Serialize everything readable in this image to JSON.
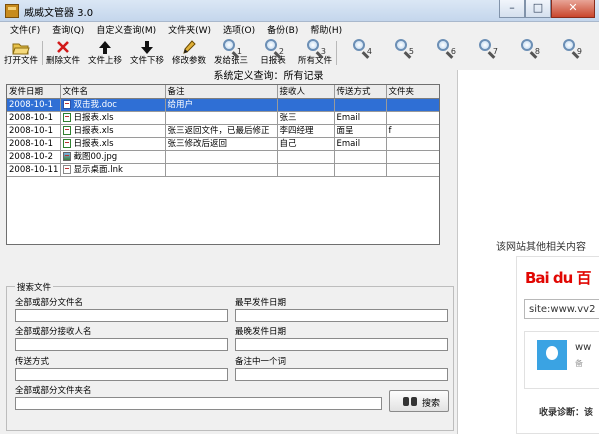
{
  "window": {
    "title": "威威文管器 3.0"
  },
  "menu": [
    "文件(F)",
    "查询(Q)",
    "自定义查询(M)",
    "文件夹(W)",
    "选项(O)",
    "备份(B)",
    "帮助(H)"
  ],
  "toolbar": [
    {
      "label": "打开文件",
      "icon": "open-folder-icon"
    },
    {
      "label": "删除文件",
      "icon": "delete-x-icon"
    },
    {
      "label": "文件上移",
      "icon": "arrow-up-icon"
    },
    {
      "label": "文件下移",
      "icon": "arrow-down-icon"
    },
    {
      "label": "修改参数",
      "icon": "pencil-icon"
    },
    {
      "label": "发给张三",
      "icon": "magnifier-icon",
      "num": "1"
    },
    {
      "label": "日报表",
      "icon": "magnifier-icon",
      "num": "2"
    },
    {
      "label": "所有文件",
      "icon": "magnifier-icon",
      "num": "3"
    },
    {
      "label": "",
      "icon": "magnifier-icon",
      "num": "4"
    },
    {
      "label": "",
      "icon": "magnifier-icon",
      "num": "5"
    },
    {
      "label": "",
      "icon": "magnifier-icon",
      "num": "6"
    },
    {
      "label": "",
      "icon": "magnifier-icon",
      "num": "7"
    },
    {
      "label": "",
      "icon": "magnifier-icon",
      "num": "8"
    },
    {
      "label": "",
      "icon": "magnifier-icon",
      "num": "9"
    }
  ],
  "query_title": "系统定义查询：所有记录",
  "table": {
    "headers": [
      "发件日期",
      "文件名",
      "备注",
      "接收人",
      "传送方式",
      "文件夹"
    ],
    "rows": [
      {
        "date": "2008-10-1",
        "type": "doc",
        "name": "双击我.doc",
        "note": "给用户",
        "recv": "",
        "method": "",
        "folder": "",
        "selected": true
      },
      {
        "date": "2008-10-1",
        "type": "xls",
        "name": "日报表.xls",
        "note": "",
        "recv": "张三",
        "method": "Email",
        "folder": ""
      },
      {
        "date": "2008-10-1",
        "type": "xls",
        "name": "日报表.xls",
        "note": "张三返回文件，已最后修正",
        "recv": "李四经理",
        "method": "面呈",
        "folder": "f"
      },
      {
        "date": "2008-10-1",
        "type": "xls",
        "name": "日报表.xls",
        "note": "张三修改后返回",
        "recv": "自己",
        "method": "Email",
        "folder": ""
      },
      {
        "date": "2008-10-2",
        "type": "jpg",
        "name": "截图00.jpg",
        "note": "",
        "recv": "",
        "method": "",
        "folder": ""
      },
      {
        "date": "2008-10-11",
        "type": "lnk",
        "name": "显示桌面.lnk",
        "note": "",
        "recv": "",
        "method": "",
        "folder": ""
      }
    ]
  },
  "search": {
    "legend": "搜索文件",
    "fields": {
      "filename": "全部或部分文件名",
      "receiver": "全部或部分接收人名",
      "method": "传送方式",
      "folder": "全部或部分文件夹名",
      "date_from": "最早发件日期",
      "date_to": "最晚发件日期",
      "note": "备注中一个词"
    },
    "button": "搜索"
  },
  "right_panel": {
    "heading": "该网站其他相关内容",
    "logo": "Bai du 百",
    "site_input": "site:www.vv2",
    "card_text": "ww",
    "card_text2": "备",
    "diagnosis": "收录诊断：该"
  }
}
